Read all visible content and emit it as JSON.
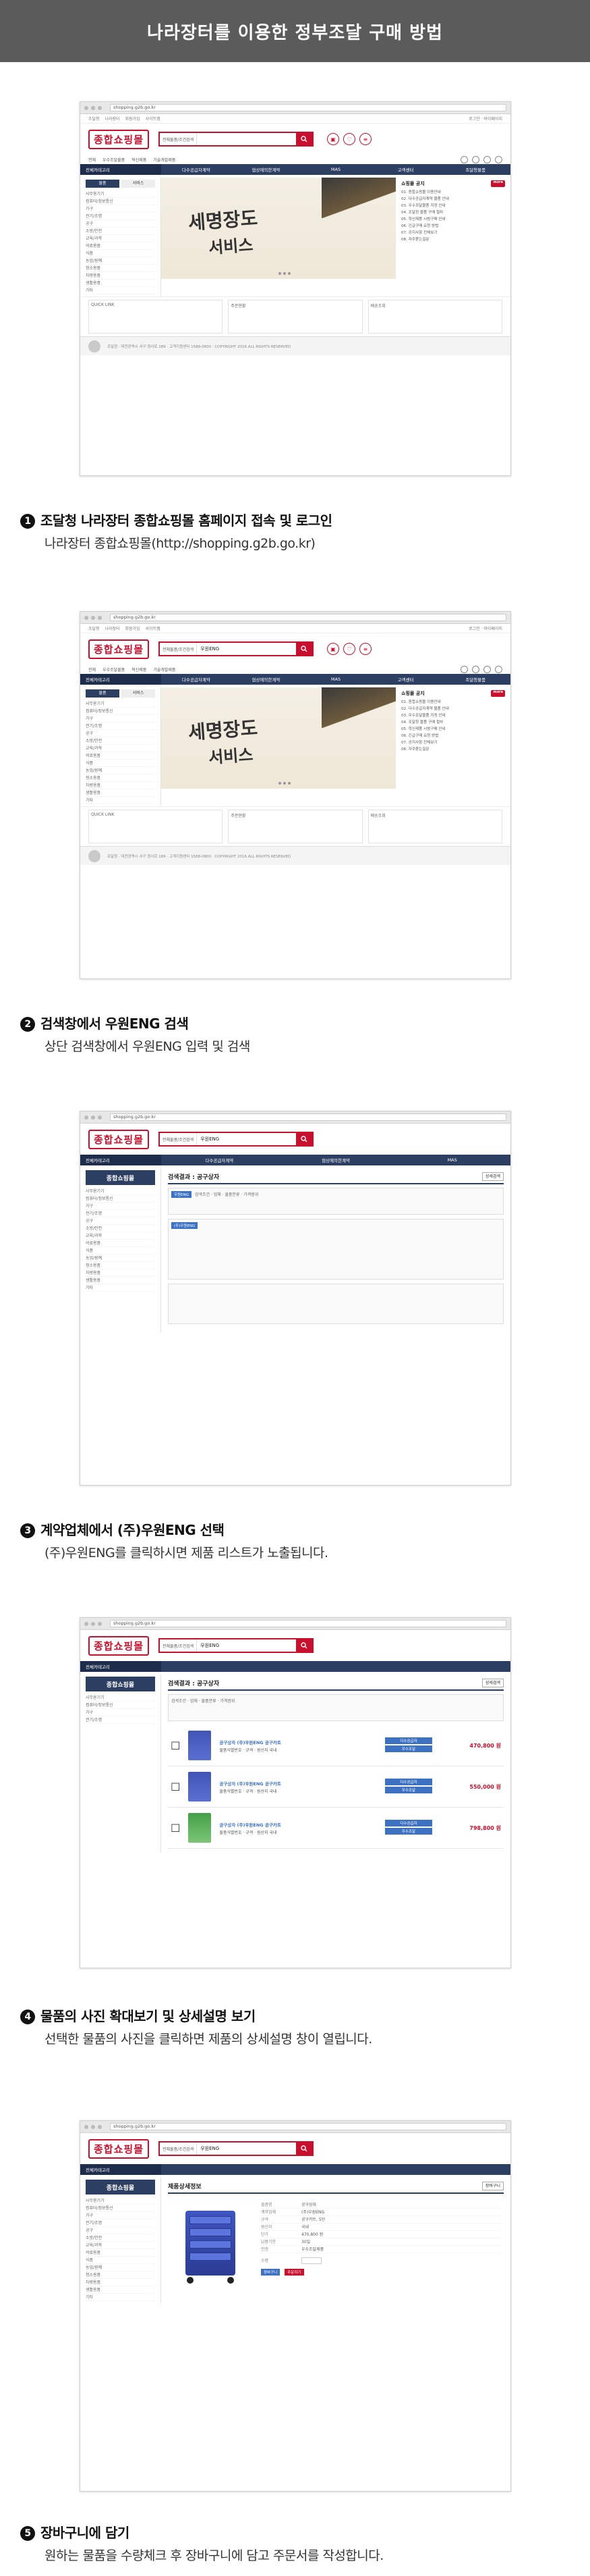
{
  "page_title": "나라장터를 이용한 정부조달 구매 방법",
  "browser": {
    "url": "shopping.g2b.go.kr"
  },
  "site": {
    "logo": "종합쇼핑몰",
    "search_select": "전체물품/조건검색",
    "search_query": "우원ENG",
    "topbar_links": [
      "조달청",
      "나라장터",
      "회원가입",
      "사이트맵"
    ],
    "topbar_right": "로그인 · 마이페이지",
    "header_icons": [
      "장바구니",
      "관심",
      "주문"
    ],
    "quick_links": [
      "전체",
      "우수조달물품",
      "혁신제품",
      "기술개발제품"
    ],
    "nav_category": "전체카테고리",
    "nav_items": [
      "다수공급자계약",
      "협상에의한계약",
      "MAS",
      "고객센터",
      "조달청물품"
    ],
    "side_tabs": [
      "물품",
      "서비스"
    ],
    "side_rows": [
      "사무용기기",
      "컴퓨터/정보통신",
      "가구",
      "전기/조명",
      "공구",
      "소방/안전",
      "교육/과학",
      "의료용품",
      "식품",
      "농업/원예",
      "청소용품",
      "차량용품",
      "생활용품",
      "기타"
    ],
    "hero_line1": "세명장도",
    "hero_line2": "서비스",
    "notice_title": "쇼핑몰 공지",
    "notice_more": "more",
    "notice_items": [
      "01. 종합쇼핑몰 이용안내",
      "02. 다수공급자계약 물품 안내",
      "03. 우수조달물품 지정 안내",
      "04. 조달청 물품 구매 절차",
      "05. 혁신제품 시범구매 안내",
      "06. 긴급구매 요청 방법",
      "07. 공지사항 전체보기",
      "08. 자주묻는질문"
    ],
    "lower_boxes": [
      "QUICK LINK",
      "주문현황",
      "배송조회"
    ],
    "footer_text": "조달청 · 대전광역시 서구 청사로 189 · 고객지원센터 1588-0800 · COPYRIGHT 2016 ALL RIGHTS RESERVED"
  },
  "list": {
    "sidebar_header": "종합쇼핑몰",
    "section_title": "검색결과 : 공구상자",
    "filter_text": "검색조건 · 업체 · 물품분류 · 가격범위",
    "count_badge": "상세검색",
    "products": [
      {
        "name": "공구상자 (주)우원ENG 공구카트",
        "desc": "물품식별번호 · 규격 · 원산지 국내",
        "price": "470,800 원",
        "tag1": "다수공급자",
        "tag2": "우수조달"
      },
      {
        "name": "공구상자 (주)우원ENG 공구카트",
        "desc": "물품식별번호 · 규격 · 원산지 국내",
        "price": "550,000 원",
        "tag1": "다수공급자",
        "tag2": "우수조달"
      },
      {
        "name": "공구상자 (주)우원ENG 공구카트",
        "desc": "물품식별번호 · 규격 · 원산지 국내",
        "price": "798,800 원",
        "tag1": "다수공급자",
        "tag2": "우수조달"
      }
    ]
  },
  "detail": {
    "section_title": "제품상세정보",
    "spec_rows": [
      {
        "k": "물품명",
        "v": "공구상자"
      },
      {
        "k": "계약업체",
        "v": "(주)우원ENG"
      },
      {
        "k": "규격",
        "v": "공구카트, 5단"
      },
      {
        "k": "원산지",
        "v": "국내"
      },
      {
        "k": "단가",
        "v": "470,800 원"
      },
      {
        "k": "납품기한",
        "v": "30일"
      },
      {
        "k": "인증",
        "v": "우수조달제품"
      }
    ],
    "qty_label": "수량",
    "cart_button": "장바구니",
    "order_button": "주문하기"
  },
  "steps": [
    {
      "num": "1",
      "title": "조달청 나라장터 종합쇼핑몰 홈페이지 접속 및 로그인",
      "sub": "나라장터 종합쇼핑몰(http://shopping.g2b.go.kr)"
    },
    {
      "num": "2",
      "title": "검색창에서 우원ENG 검색",
      "sub": "상단 검색창에서 우원ENG 입력 및 검색"
    },
    {
      "num": "3",
      "title": "계약업체에서 (주)우원ENG 선택",
      "sub": "(주)우원ENG를 클릭하시면 제품 리스트가 노출됩니다."
    },
    {
      "num": "4",
      "title": "물품의 사진 확대보기 및 상세설명 보기",
      "sub": "선택한 물품의 사진을 클릭하면 제품의 상세설명 창이 열립니다."
    },
    {
      "num": "5",
      "title": "장바구니에 담기",
      "sub": "원하는 물품을 수량체크 후 장바구니에 담고 주문서를 작성합니다."
    }
  ]
}
